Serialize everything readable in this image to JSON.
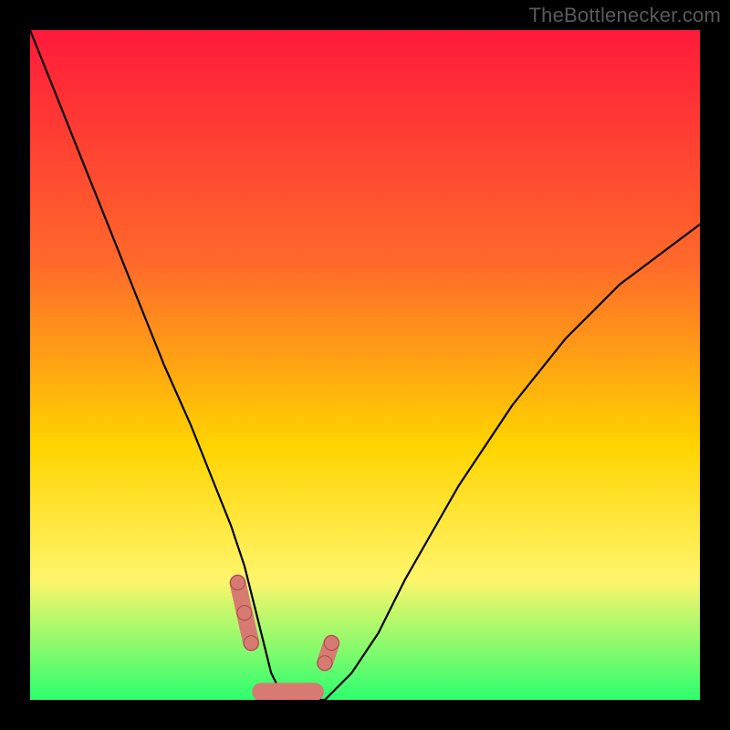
{
  "watermark": "TheBottlenecker.com",
  "colors": {
    "frame": "#000000",
    "grad_top": "#ff1a3a",
    "grad_mid_top": "#ff6a2a",
    "grad_mid": "#ffd400",
    "grad_lower": "#fff56b",
    "grad_bottom": "#2cff6e",
    "curve": "#000000",
    "marker_fill": "#d77a72",
    "marker_stroke": "#a54c48"
  },
  "chart_data": {
    "type": "line",
    "title": "",
    "xlabel": "",
    "ylabel": "",
    "xlim": [
      0,
      100
    ],
    "ylim": [
      0,
      100
    ],
    "x": [
      0,
      4,
      8,
      12,
      16,
      20,
      24,
      28,
      30,
      32,
      34,
      36,
      38,
      40,
      44,
      48,
      52,
      56,
      60,
      64,
      68,
      72,
      76,
      80,
      84,
      88,
      92,
      96,
      100
    ],
    "values": [
      100,
      90,
      80,
      70,
      60,
      50,
      41,
      31,
      26,
      20,
      12,
      4,
      0,
      0,
      0,
      4,
      10,
      18,
      25,
      32,
      38,
      44,
      49,
      54,
      58,
      62,
      65,
      68,
      71
    ],
    "markers": {
      "left": {
        "x": [
          31.0,
          32.0,
          33.0
        ],
        "y": [
          17.5,
          13.0,
          8.5
        ]
      },
      "right": {
        "x": [
          44.0,
          45.0
        ],
        "y": [
          5.5,
          8.5
        ]
      },
      "bottom_band": {
        "x_start": 34.5,
        "x_end": 42.5,
        "y": 1.2
      }
    }
  }
}
